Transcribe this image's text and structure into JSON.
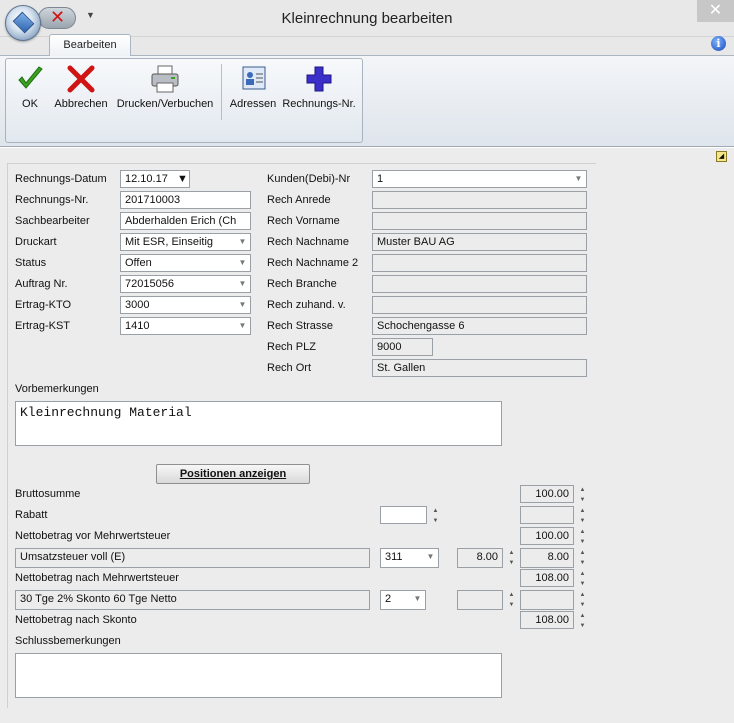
{
  "window": {
    "title": "Kleinrechnung bearbeiten",
    "close": "✕"
  },
  "ribbon": {
    "tab": "Bearbeiten",
    "help": "i",
    "buttons": {
      "ok": "OK",
      "abbrechen": "Abbrechen",
      "drucken": "Drucken/Verbuchen",
      "adressen": "Adressen",
      "rechnungsnr": "Rechnungs-Nr."
    }
  },
  "left": {
    "rechnungs_datum": {
      "label": "Rechnungs-Datum",
      "value": "12.10.17"
    },
    "rechnungs_nr": {
      "label": "Rechnungs-Nr.",
      "value": "201710003"
    },
    "sachbearbeiter": {
      "label": "Sachbearbeiter",
      "value": "Abderhalden Erich (Ch"
    },
    "druckart": {
      "label": "Druckart",
      "value": "Mit ESR, Einseitig"
    },
    "status": {
      "label": "Status",
      "value": "Offen"
    },
    "auftrag_nr": {
      "label": "Auftrag Nr.",
      "value": "72015056"
    },
    "ertrag_kto": {
      "label": "Ertrag-KTO",
      "value": "3000"
    },
    "ertrag_kst": {
      "label": "Ertrag-KST",
      "value": "1410"
    }
  },
  "right": {
    "kunden_nr": {
      "label": "Kunden(Debi)-Nr",
      "value": "1"
    },
    "anrede": {
      "label": "Rech Anrede",
      "value": ""
    },
    "vorname": {
      "label": "Rech Vorname",
      "value": ""
    },
    "nachname": {
      "label": "Rech Nachname",
      "value": "Muster BAU AG"
    },
    "nachname2": {
      "label": "Rech Nachname 2",
      "value": ""
    },
    "branche": {
      "label": "Rech Branche",
      "value": ""
    },
    "zuhand": {
      "label": "Rech zuhand. v.",
      "value": ""
    },
    "strasse": {
      "label": "Rech Strasse",
      "value": "Schochengasse 6"
    },
    "plz": {
      "label": "Rech PLZ",
      "value": "9000"
    },
    "ort": {
      "label": "Rech Ort",
      "value": "St. Gallen"
    }
  },
  "vorbemerkungen": {
    "label": "Vorbemerkungen",
    "value": "Kleinrechnung Material"
  },
  "positionen_button": "Positionen anzeigen",
  "totals": {
    "bruttosumme": {
      "label": "Bruttosumme",
      "value": "100.00"
    },
    "rabatt": {
      "label": "Rabatt",
      "value": "",
      "amount": ""
    },
    "netto_vor": {
      "label": "Nettobetrag vor Mehrwertsteuer",
      "value": "100.00"
    },
    "ust": {
      "label": "Umsatzsteuer voll (E)",
      "code": "311",
      "rate": "8.00",
      "amount": "8.00"
    },
    "netto_nach": {
      "label": "Nettobetrag nach Mehrwertsteuer",
      "value": "108.00"
    },
    "skonto": {
      "label": "30 Tge 2% Skonto 60 Tge Netto",
      "code": "2",
      "rate": "",
      "amount": ""
    },
    "netto_skonto": {
      "label": "Nettobetrag nach Skonto",
      "value": "108.00"
    }
  },
  "schlussbemerkungen": {
    "label": "Schlussbemerkungen",
    "value": ""
  },
  "colors": {
    "accent": "#2e64b0",
    "ok": "#3aa321",
    "cancel": "#d01414",
    "plus": "#3a2fc9"
  }
}
